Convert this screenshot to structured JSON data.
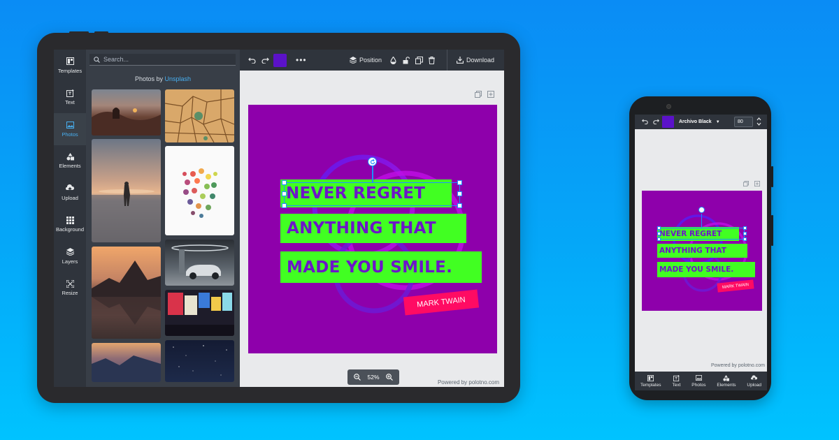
{
  "editor": {
    "sidebar": {
      "items": [
        {
          "label": "Templates",
          "icon": "templates-icon",
          "active": false
        },
        {
          "label": "Text",
          "icon": "text-icon",
          "active": false
        },
        {
          "label": "Photos",
          "icon": "photos-icon",
          "active": true
        },
        {
          "label": "Elements",
          "icon": "elements-icon",
          "active": false
        },
        {
          "label": "Upload",
          "icon": "upload-icon",
          "active": false
        },
        {
          "label": "Background",
          "icon": "background-icon",
          "active": false
        },
        {
          "label": "Layers",
          "icon": "layers-icon",
          "active": false
        },
        {
          "label": "Resize",
          "icon": "resize-icon",
          "active": false
        }
      ]
    },
    "photos_panel": {
      "search_placeholder": "Search...",
      "title_prefix": "Photos by",
      "title_link": "Unsplash"
    },
    "toolbar": {
      "fill_color": "#5b12c9",
      "position_label": "Position",
      "download_label": "Download"
    },
    "canvas": {
      "background": "#8e00ab",
      "quote_lines": [
        "NEVER REGRET",
        "ANYTHING THAT",
        "MADE YOU SMILE."
      ],
      "author": "MARK TWAIN",
      "highlight_color": "#41ff22",
      "text_color": "#6d16c8",
      "author_bg": "#ff0b63"
    },
    "zoom_label": "52%",
    "powered_by": "Powered by polotno.com"
  },
  "mobile": {
    "font_name": "Archivo Black",
    "font_size": "80",
    "powered_by": "Powered by polotno.com",
    "nav": [
      {
        "label": "Templates",
        "icon": "templates-icon"
      },
      {
        "label": "Text",
        "icon": "text-icon"
      },
      {
        "label": "Photos",
        "icon": "photos-icon"
      },
      {
        "label": "Elements",
        "icon": "elements-icon"
      },
      {
        "label": "Upload",
        "icon": "upload-icon"
      }
    ]
  }
}
